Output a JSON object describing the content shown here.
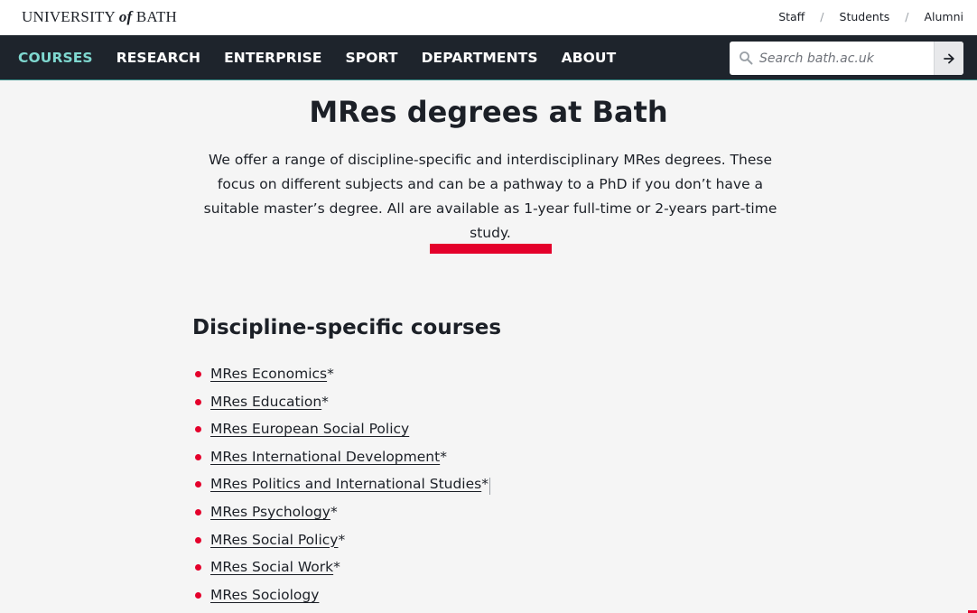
{
  "header": {
    "logo": {
      "part1": "UNIVERSITY ",
      "part2": "of",
      "part3": " BATH"
    },
    "top_links": [
      "Staff",
      "Students",
      "Alumni"
    ],
    "separator": "/"
  },
  "nav": {
    "items": [
      {
        "label": "COURSES",
        "active": true
      },
      {
        "label": "RESEARCH",
        "active": false
      },
      {
        "label": "ENTERPRISE",
        "active": false
      },
      {
        "label": "SPORT",
        "active": false
      },
      {
        "label": "DEPARTMENTS",
        "active": false
      },
      {
        "label": "ABOUT",
        "active": false
      }
    ],
    "search_placeholder": "Search bath.ac.uk"
  },
  "hero": {
    "title": "MRes degrees at Bath",
    "intro": "We offer a range of discipline-specific and interdisciplinary MRes degrees. These focus on different subjects and can be a pathway to a PhD if you don’t have a suitable master’s degree. All are available as 1-year full-time or 2-years part-time study."
  },
  "discipline": {
    "title": "Discipline-specific courses",
    "courses": [
      {
        "name": "MRes Economics",
        "suffix": "*"
      },
      {
        "name": "MRes Education",
        "suffix": "*"
      },
      {
        "name": "MRes European Social Policy",
        "suffix": ""
      },
      {
        "name": "MRes International Development",
        "suffix": "*"
      },
      {
        "name": "MRes Politics and International Studies",
        "suffix": "*"
      },
      {
        "name": "MRes Psychology",
        "suffix": "*"
      },
      {
        "name": "MRes Social Policy",
        "suffix": "*"
      },
      {
        "name": "MRes Social Work",
        "suffix": "*"
      },
      {
        "name": "MRes Sociology",
        "suffix": ""
      }
    ]
  },
  "colors": {
    "brand_red": "#e4002b",
    "nav_bg": "#1e242c",
    "nav_active": "#7fd8d0",
    "page_bg": "#f5f5f5"
  },
  "icons": {
    "search": "magnifier-icon",
    "submit": "arrow-right-icon"
  }
}
